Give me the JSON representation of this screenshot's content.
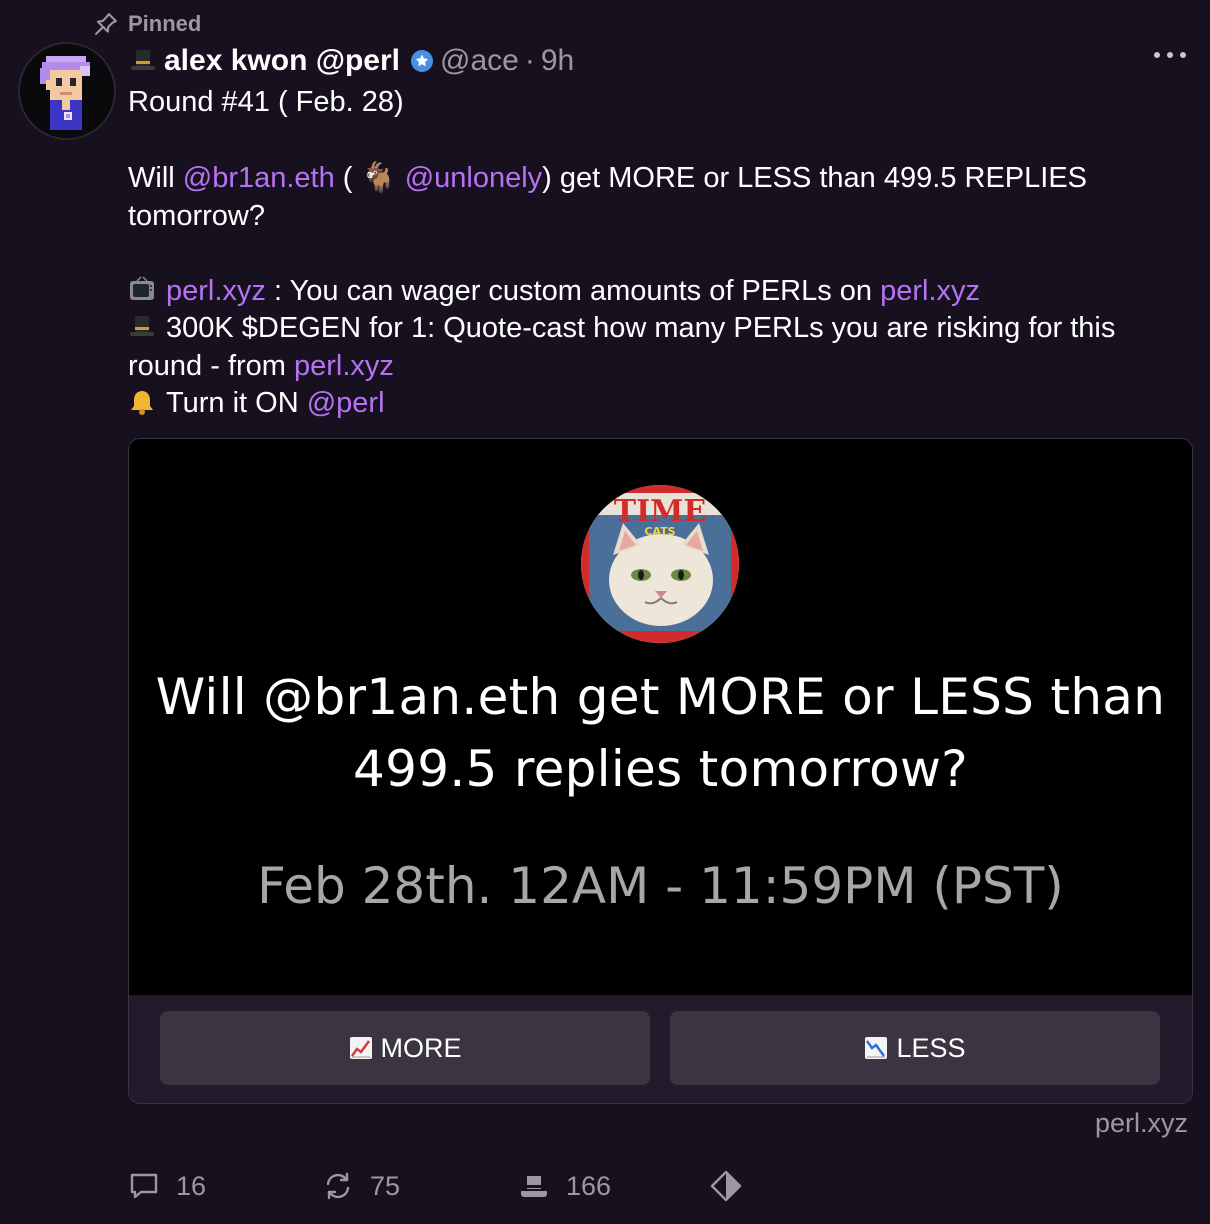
{
  "pinned_label": "Pinned",
  "author": {
    "display_name": "alex kwon @perl",
    "handle": "@ace",
    "separator": "·",
    "time": "9h"
  },
  "body": {
    "line1": "Round #41 ( Feb. 28)",
    "q_will": "Will ",
    "q_mention1": "@br1an.eth",
    "q_paren_open": " ( ",
    "q_goat_emoji": "🐐",
    "q_mention2": "@unlonely",
    "q_rest": ") get MORE or LESS than 499.5 REPLIES tomorrow?",
    "tv_link1": "perl.xyz",
    "tv_text": " : You can wager custom amounts of PERLs on ",
    "tv_link2": "perl.xyz",
    "degen_text": "300K $DEGEN for 1: Quote-cast how many PERLs you are risking for this round - from ",
    "degen_link": "perl.xyz",
    "bell_text": "Turn it ON ",
    "bell_link": "@perl"
  },
  "frame": {
    "title": "Will @br1an.eth get MORE or LESS than 499.5 replies tomorrow?",
    "subtitle": "Feb 28th. 12AM - 11:59PM (PST)",
    "badge_text": "TIME",
    "badge_sub": "CATS",
    "button_more": "MORE",
    "button_less": "LESS",
    "domain": "perl.xyz"
  },
  "actions": {
    "replies": "16",
    "recasts": "75",
    "tips": "166"
  },
  "colors": {
    "background": "#17101f",
    "link": "#b672f2",
    "muted": "#9b98a3",
    "button": "#3b3542"
  }
}
